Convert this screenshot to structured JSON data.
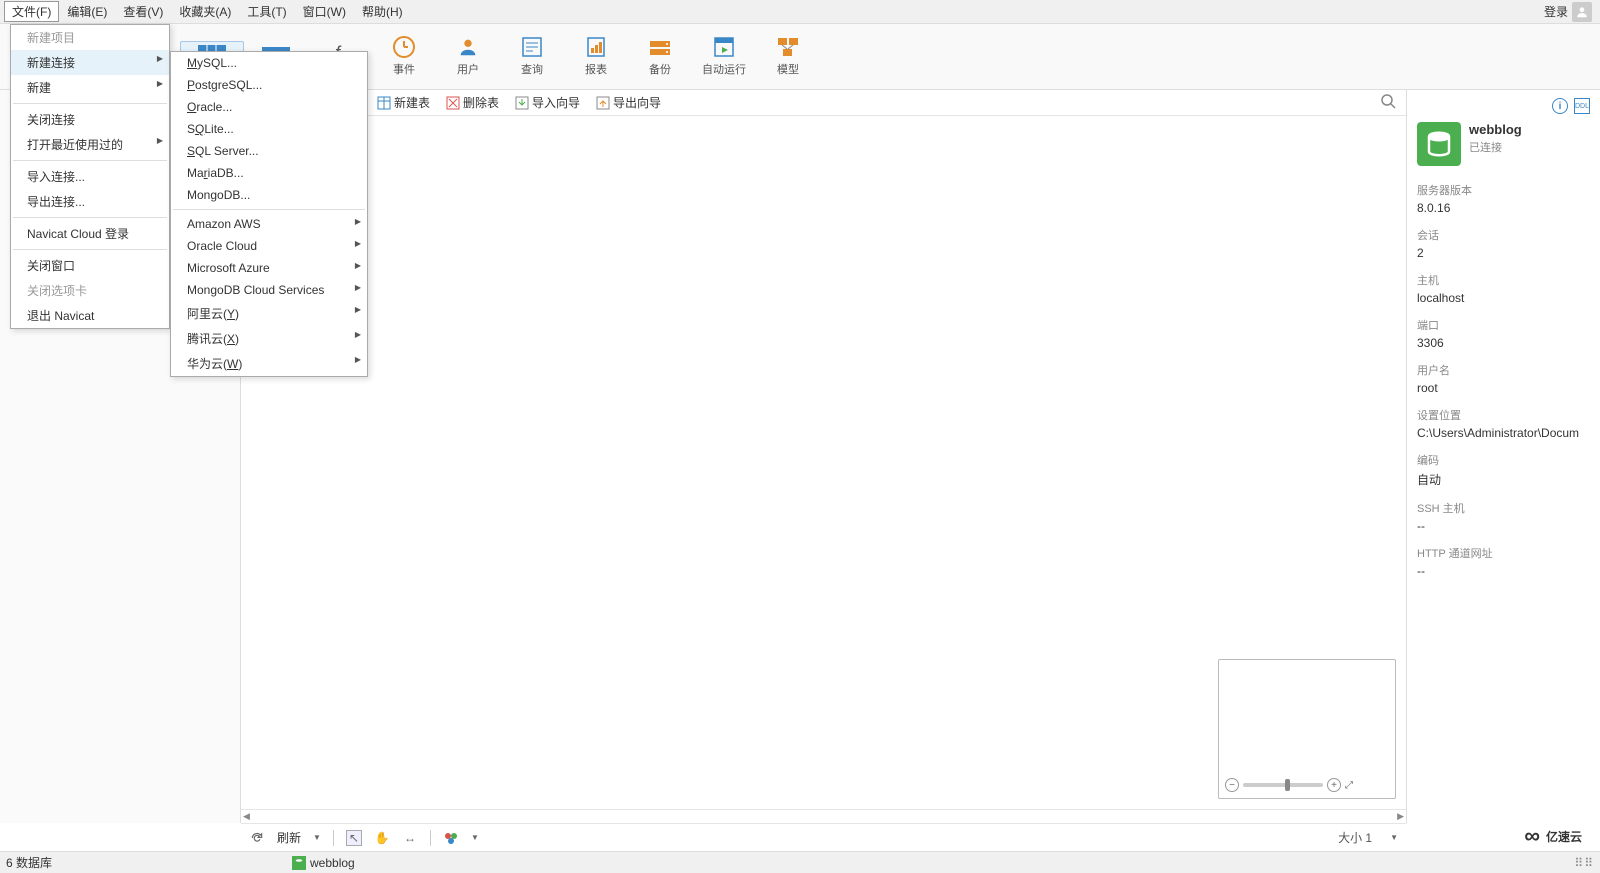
{
  "menubar": {
    "items": [
      {
        "label": "文件(F)"
      },
      {
        "label": "编辑(E)"
      },
      {
        "label": "查看(V)"
      },
      {
        "label": "收藏夹(A)"
      },
      {
        "label": "工具(T)"
      },
      {
        "label": "窗口(W)"
      },
      {
        "label": "帮助(H)"
      }
    ],
    "login": "登录"
  },
  "toolbar": [
    {
      "label": "",
      "color": "#3a87c8"
    },
    {
      "label": "",
      "color": "#3a87c8"
    },
    {
      "label": "",
      "color": "#444",
      "fx": true
    },
    {
      "label": "事件",
      "color": "#e28c2b"
    },
    {
      "label": "用户",
      "color": "#e28c2b"
    },
    {
      "label": "查询",
      "color": "#3a87c8"
    },
    {
      "label": "报表",
      "color": "#3a87c8"
    },
    {
      "label": "备份",
      "color": "#e28c2b"
    },
    {
      "label": "自动运行",
      "color": "#3a87c8"
    },
    {
      "label": "模型",
      "color": "#e28c2b"
    }
  ],
  "file_menu": [
    {
      "label": "新建项目",
      "disabled": true
    },
    {
      "label": "新建连接",
      "sub": true,
      "hl": true
    },
    {
      "label": "新建",
      "sub": true
    },
    {
      "sep": true
    },
    {
      "label": "关闭连接"
    },
    {
      "label": "打开最近使用过的",
      "sub": true
    },
    {
      "sep": true
    },
    {
      "label": "导入连接..."
    },
    {
      "label": "导出连接..."
    },
    {
      "sep": true
    },
    {
      "label": "Navicat Cloud 登录"
    },
    {
      "sep": true
    },
    {
      "label": "关闭窗口"
    },
    {
      "label": "关闭选项卡",
      "disabled": true
    },
    {
      "label": "退出 Navicat"
    }
  ],
  "conn_menu": [
    {
      "label": "MySQL...",
      "u": "M"
    },
    {
      "label": "PostgreSQL...",
      "u": "P"
    },
    {
      "label": "Oracle...",
      "u": "O"
    },
    {
      "label": "SQLite...",
      "u": "Q"
    },
    {
      "label": "SQL Server...",
      "u": "S"
    },
    {
      "label": "MariaDB...",
      "u": "r"
    },
    {
      "label": "MongoDB...",
      "u": "g"
    },
    {
      "sep": true
    },
    {
      "label": "Amazon AWS",
      "sub": true
    },
    {
      "label": "Oracle Cloud",
      "sub": true
    },
    {
      "label": "Microsoft Azure",
      "sub": true
    },
    {
      "label": "MongoDB Cloud Services",
      "sub": true
    },
    {
      "label": "阿里云(Y)",
      "sub": true,
      "u": "Y"
    },
    {
      "label": "腾讯云(X)",
      "sub": true,
      "u": "X"
    },
    {
      "label": "华为云(W)",
      "sub": true,
      "u": "W"
    }
  ],
  "subtoolbar": [
    {
      "label": "新建表"
    },
    {
      "label": "删除表"
    },
    {
      "label": "导入向导"
    },
    {
      "label": "导出向导"
    }
  ],
  "centerbottom": {
    "refresh": "刷新",
    "size": "大小 1"
  },
  "rightpane": {
    "conn_name": "webblog",
    "conn_status": "已连接",
    "props": [
      {
        "label": "服务器版本",
        "val": "8.0.16"
      },
      {
        "label": "会话",
        "val": "2"
      },
      {
        "label": "主机",
        "val": "localhost"
      },
      {
        "label": "端口",
        "val": "3306"
      },
      {
        "label": "用户名",
        "val": "root"
      },
      {
        "label": "设置位置",
        "val": "C:\\Users\\Administrator\\Docum"
      },
      {
        "label": "编码",
        "val": "自动"
      },
      {
        "label": "SSH 主机",
        "val": "--"
      },
      {
        "label": "HTTP 通道网址",
        "val": "--"
      }
    ]
  },
  "statusbar": {
    "dbcount": "6 数据库",
    "conn": "webblog"
  },
  "watermark": "亿速云"
}
